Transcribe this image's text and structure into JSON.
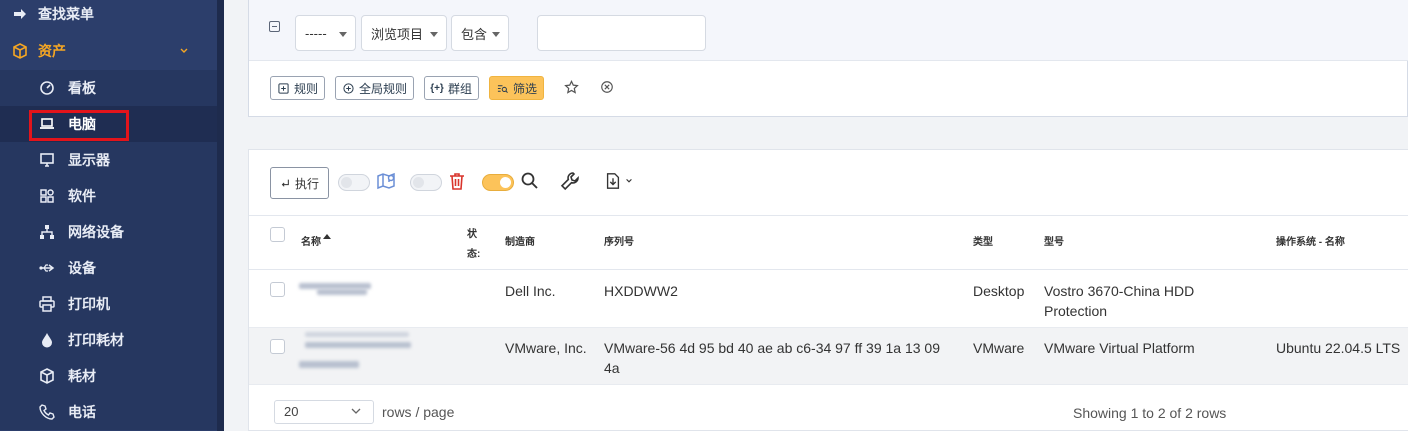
{
  "sidebar": {
    "items": [
      {
        "label": "查找菜单",
        "icon": "arrow-right-to-bracket-icon"
      },
      {
        "label": "资产",
        "icon": "cube-icon"
      },
      {
        "label": "看板",
        "icon": "gauge-icon"
      },
      {
        "label": "电脑",
        "icon": "laptop-icon"
      },
      {
        "label": "显示器",
        "icon": "monitor-icon"
      },
      {
        "label": "软件",
        "icon": "apps-icon"
      },
      {
        "label": "网络设备",
        "icon": "network-icon"
      },
      {
        "label": "设备",
        "icon": "usb-icon"
      },
      {
        "label": "打印机",
        "icon": "printer-icon"
      },
      {
        "label": "打印耗材",
        "icon": "ink-drop-icon"
      },
      {
        "label": "耗材",
        "icon": "package-icon"
      },
      {
        "label": "电话",
        "icon": "phone-icon"
      }
    ],
    "active_item": "电脑"
  },
  "criteria": {
    "field": "-----",
    "item_type": "浏览项目",
    "operator": "包含",
    "value": ""
  },
  "rule_buttons": {
    "rule": "规则",
    "global_rule": "全局规则",
    "group": "群组",
    "filter": "筛选"
  },
  "toolbar": {
    "execute": "执行",
    "map_toggle_on": false,
    "trash_toggle_on": false,
    "search_toggle_on": true
  },
  "table": {
    "headers": {
      "name": "名称",
      "status": "状态:",
      "manufacturer": "制造商",
      "serial": "序列号",
      "type": "类型",
      "model": "型号",
      "os": "操作系统 - 名称"
    },
    "rows": [
      {
        "manufacturer": "Dell Inc.",
        "serial": "HXDDWW2",
        "type": "Desktop",
        "model": "Vostro 3670-China HDD Protection",
        "os": ""
      },
      {
        "manufacturer": "VMware, Inc.",
        "serial": "VMware-56 4d 95 bd 40 ae ab c6-34 97 ff 39 1a 13 09 4a",
        "type": "VMware",
        "model": "VMware Virtual Platform",
        "os": "Ubuntu 22.04.5 LTS"
      }
    ]
  },
  "pagination": {
    "page_size": "20",
    "rows_label": "rows / page",
    "showing": "Showing 1 to 2 of 2 rows"
  },
  "colors": {
    "sidebar_bg": "#2c3e6b",
    "accent": "#f5a623",
    "filter_button": "#fcc35a",
    "highlight_box": "#e3141b",
    "trash_icon": "#d9342b",
    "map_icon": "#6b8fd6"
  }
}
